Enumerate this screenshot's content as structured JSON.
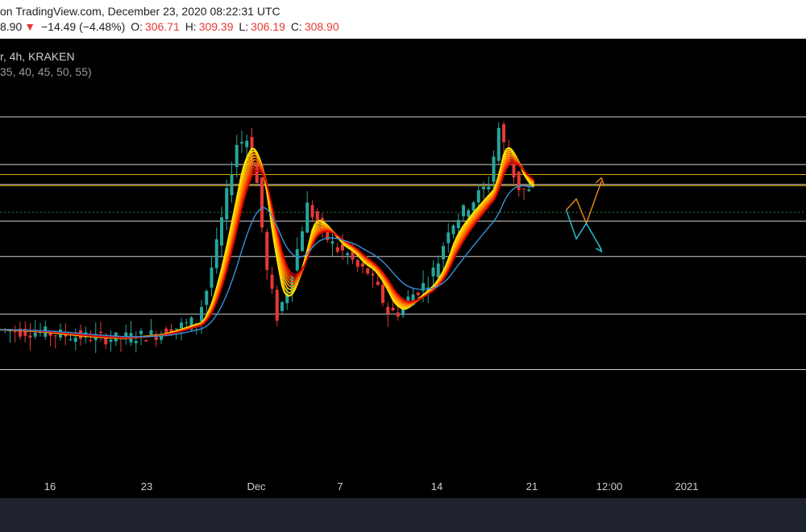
{
  "header": {
    "line1": "on TradingView.com, December 23, 2020 08:22:31 UTC",
    "price": "8.90",
    "change": "−14.49 (−4.48%)",
    "open_label": "O:",
    "open": "306.71",
    "high_label": "H:",
    "high": "309.39",
    "low_label": "L:",
    "low": "306.19",
    "close_label": "C:",
    "close": "308.90"
  },
  "legend": {
    "symbol_line": "r, 4h, KRAKEN",
    "indicator_line": "35, 40, 45, 50, 55)"
  },
  "colors": {
    "up": "#26a69a",
    "down": "#e53935",
    "ribbon_top": "#ffd600",
    "ribbon_bottom": "#d50000",
    "blue_line": "#3b8fd6",
    "level_line": "#cfcfcf",
    "orange_level": "#e0a800",
    "green_dotted": "#2e7d32",
    "projection_orange": "#ef8a1a",
    "projection_cyan": "#26c6da"
  },
  "chart_data": {
    "type": "candlestick",
    "x_ticks": [
      "16",
      "23",
      "Dec",
      "7",
      "14",
      "21",
      "12:00",
      "2021"
    ],
    "ylim": [
      180,
      360
    ],
    "price_series": [
      {
        "x": 0,
        "v": 244
      },
      {
        "x": 4,
        "v": 243
      },
      {
        "x": 8,
        "v": 241
      },
      {
        "x": 12,
        "v": 240
      },
      {
        "x": 16,
        "v": 242
      },
      {
        "x": 20,
        "v": 248
      },
      {
        "x": 21,
        "v": 262
      },
      {
        "x": 22,
        "v": 282
      },
      {
        "x": 23,
        "v": 305
      },
      {
        "x": 24,
        "v": 328
      },
      {
        "x": 25,
        "v": 330
      },
      {
        "x": 26,
        "v": 310
      },
      {
        "x": 27,
        "v": 270
      },
      {
        "x": 28,
        "v": 250
      },
      {
        "x": 29,
        "v": 262
      },
      {
        "x": 30,
        "v": 280
      },
      {
        "x": 31,
        "v": 300
      },
      {
        "x": 32,
        "v": 292
      },
      {
        "x": 33,
        "v": 285
      },
      {
        "x": 34,
        "v": 280
      },
      {
        "x": 35,
        "v": 278
      },
      {
        "x": 36,
        "v": 272
      },
      {
        "x": 37,
        "v": 270
      },
      {
        "x": 38,
        "v": 262
      },
      {
        "x": 39,
        "v": 252
      },
      {
        "x": 40,
        "v": 252
      },
      {
        "x": 41,
        "v": 258
      },
      {
        "x": 42,
        "v": 262
      },
      {
        "x": 43,
        "v": 266
      },
      {
        "x": 44,
        "v": 275
      },
      {
        "x": 45,
        "v": 290
      },
      {
        "x": 46,
        "v": 295
      },
      {
        "x": 47,
        "v": 300
      },
      {
        "x": 48,
        "v": 305
      },
      {
        "x": 49,
        "v": 310
      },
      {
        "x": 50,
        "v": 335
      },
      {
        "x": 51,
        "v": 320
      },
      {
        "x": 52,
        "v": 308
      },
      {
        "x": 53,
        "v": 306
      }
    ],
    "ribbon_peaks": "EMA ribbon lengths 35-55",
    "horizontal_levels": [
      340,
      318.5,
      309.5,
      293,
      277,
      251,
      226
    ],
    "orange_levels": [
      314,
      309
    ],
    "green_dotted_level": 297,
    "projection_orange": [
      [
        53,
        298
      ],
      [
        54,
        303
      ],
      [
        55,
        292
      ],
      [
        56.5,
        311
      ]
    ],
    "projection_cyan": [
      [
        53,
        298
      ],
      [
        54,
        285
      ],
      [
        55,
        292
      ],
      [
        56.5,
        280
      ]
    ]
  }
}
